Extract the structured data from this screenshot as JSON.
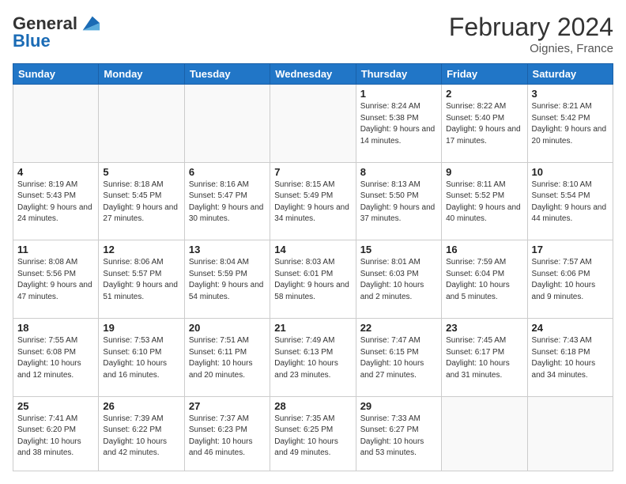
{
  "logo": {
    "general": "General",
    "blue": "Blue"
  },
  "header": {
    "month_year": "February 2024",
    "location": "Oignies, France"
  },
  "weekdays": [
    "Sunday",
    "Monday",
    "Tuesday",
    "Wednesday",
    "Thursday",
    "Friday",
    "Saturday"
  ],
  "weeks": [
    [
      {
        "day": "",
        "info": ""
      },
      {
        "day": "",
        "info": ""
      },
      {
        "day": "",
        "info": ""
      },
      {
        "day": "",
        "info": ""
      },
      {
        "day": "1",
        "info": "Sunrise: 8:24 AM\nSunset: 5:38 PM\nDaylight: 9 hours\nand 14 minutes."
      },
      {
        "day": "2",
        "info": "Sunrise: 8:22 AM\nSunset: 5:40 PM\nDaylight: 9 hours\nand 17 minutes."
      },
      {
        "day": "3",
        "info": "Sunrise: 8:21 AM\nSunset: 5:42 PM\nDaylight: 9 hours\nand 20 minutes."
      }
    ],
    [
      {
        "day": "4",
        "info": "Sunrise: 8:19 AM\nSunset: 5:43 PM\nDaylight: 9 hours\nand 24 minutes."
      },
      {
        "day": "5",
        "info": "Sunrise: 8:18 AM\nSunset: 5:45 PM\nDaylight: 9 hours\nand 27 minutes."
      },
      {
        "day": "6",
        "info": "Sunrise: 8:16 AM\nSunset: 5:47 PM\nDaylight: 9 hours\nand 30 minutes."
      },
      {
        "day": "7",
        "info": "Sunrise: 8:15 AM\nSunset: 5:49 PM\nDaylight: 9 hours\nand 34 minutes."
      },
      {
        "day": "8",
        "info": "Sunrise: 8:13 AM\nSunset: 5:50 PM\nDaylight: 9 hours\nand 37 minutes."
      },
      {
        "day": "9",
        "info": "Sunrise: 8:11 AM\nSunset: 5:52 PM\nDaylight: 9 hours\nand 40 minutes."
      },
      {
        "day": "10",
        "info": "Sunrise: 8:10 AM\nSunset: 5:54 PM\nDaylight: 9 hours\nand 44 minutes."
      }
    ],
    [
      {
        "day": "11",
        "info": "Sunrise: 8:08 AM\nSunset: 5:56 PM\nDaylight: 9 hours\nand 47 minutes."
      },
      {
        "day": "12",
        "info": "Sunrise: 8:06 AM\nSunset: 5:57 PM\nDaylight: 9 hours\nand 51 minutes."
      },
      {
        "day": "13",
        "info": "Sunrise: 8:04 AM\nSunset: 5:59 PM\nDaylight: 9 hours\nand 54 minutes."
      },
      {
        "day": "14",
        "info": "Sunrise: 8:03 AM\nSunset: 6:01 PM\nDaylight: 9 hours\nand 58 minutes."
      },
      {
        "day": "15",
        "info": "Sunrise: 8:01 AM\nSunset: 6:03 PM\nDaylight: 10 hours\nand 2 minutes."
      },
      {
        "day": "16",
        "info": "Sunrise: 7:59 AM\nSunset: 6:04 PM\nDaylight: 10 hours\nand 5 minutes."
      },
      {
        "day": "17",
        "info": "Sunrise: 7:57 AM\nSunset: 6:06 PM\nDaylight: 10 hours\nand 9 minutes."
      }
    ],
    [
      {
        "day": "18",
        "info": "Sunrise: 7:55 AM\nSunset: 6:08 PM\nDaylight: 10 hours\nand 12 minutes."
      },
      {
        "day": "19",
        "info": "Sunrise: 7:53 AM\nSunset: 6:10 PM\nDaylight: 10 hours\nand 16 minutes."
      },
      {
        "day": "20",
        "info": "Sunrise: 7:51 AM\nSunset: 6:11 PM\nDaylight: 10 hours\nand 20 minutes."
      },
      {
        "day": "21",
        "info": "Sunrise: 7:49 AM\nSunset: 6:13 PM\nDaylight: 10 hours\nand 23 minutes."
      },
      {
        "day": "22",
        "info": "Sunrise: 7:47 AM\nSunset: 6:15 PM\nDaylight: 10 hours\nand 27 minutes."
      },
      {
        "day": "23",
        "info": "Sunrise: 7:45 AM\nSunset: 6:17 PM\nDaylight: 10 hours\nand 31 minutes."
      },
      {
        "day": "24",
        "info": "Sunrise: 7:43 AM\nSunset: 6:18 PM\nDaylight: 10 hours\nand 34 minutes."
      }
    ],
    [
      {
        "day": "25",
        "info": "Sunrise: 7:41 AM\nSunset: 6:20 PM\nDaylight: 10 hours\nand 38 minutes."
      },
      {
        "day": "26",
        "info": "Sunrise: 7:39 AM\nSunset: 6:22 PM\nDaylight: 10 hours\nand 42 minutes."
      },
      {
        "day": "27",
        "info": "Sunrise: 7:37 AM\nSunset: 6:23 PM\nDaylight: 10 hours\nand 46 minutes."
      },
      {
        "day": "28",
        "info": "Sunrise: 7:35 AM\nSunset: 6:25 PM\nDaylight: 10 hours\nand 49 minutes."
      },
      {
        "day": "29",
        "info": "Sunrise: 7:33 AM\nSunset: 6:27 PM\nDaylight: 10 hours\nand 53 minutes."
      },
      {
        "day": "",
        "info": ""
      },
      {
        "day": "",
        "info": ""
      }
    ]
  ]
}
